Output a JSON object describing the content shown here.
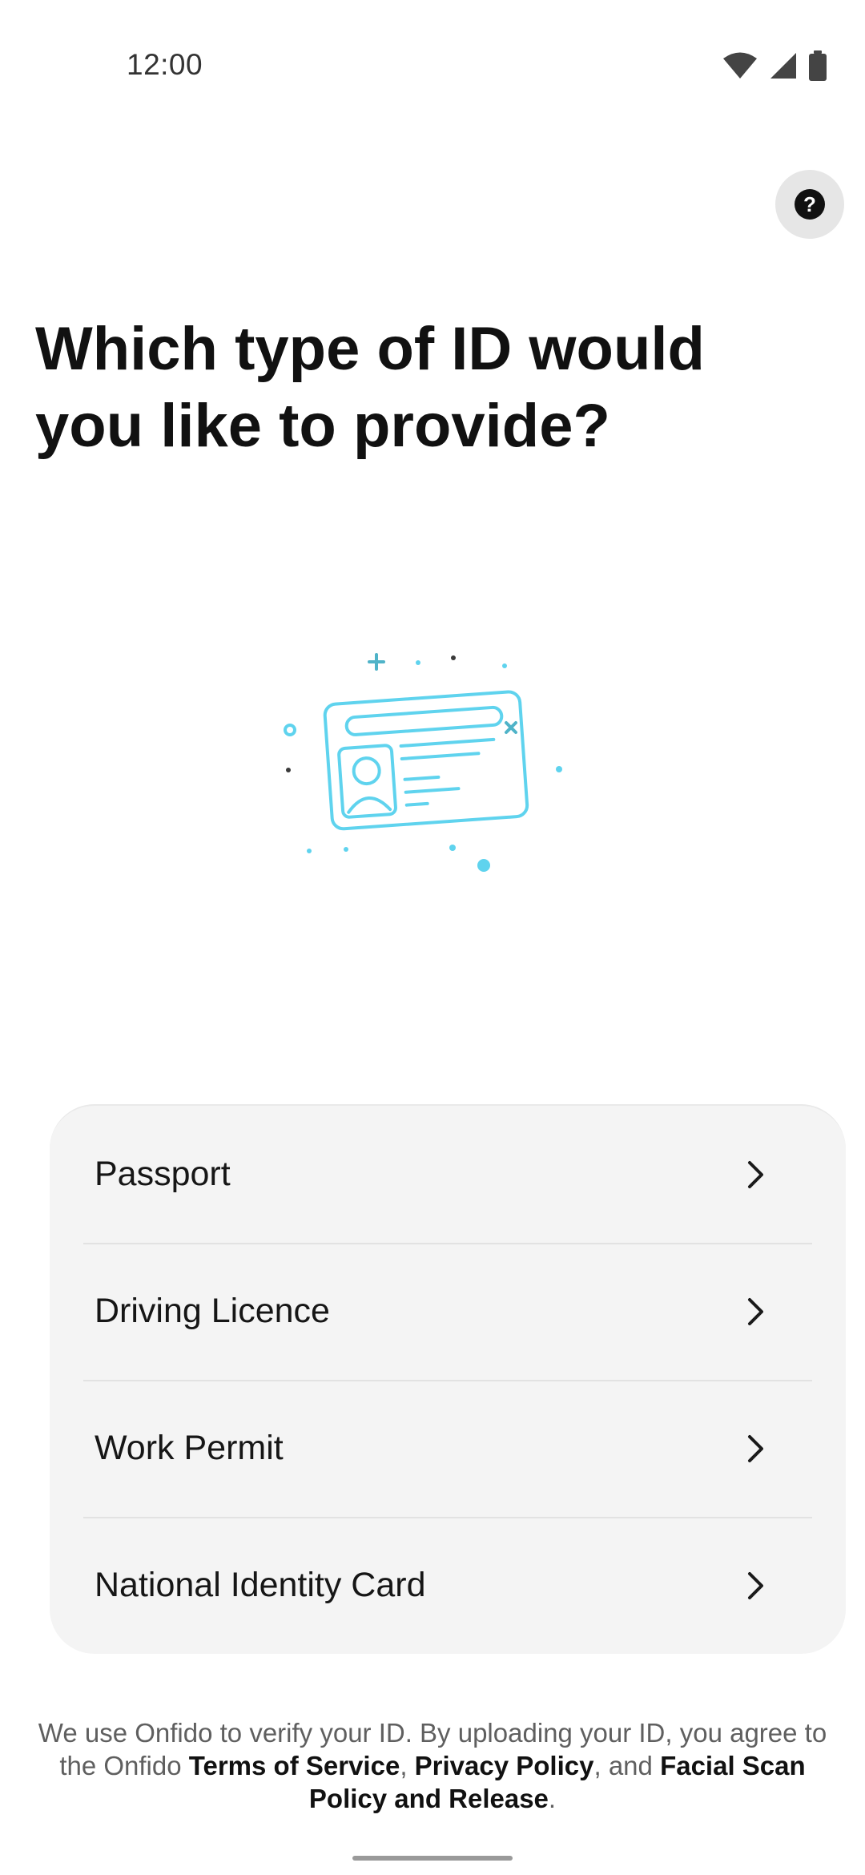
{
  "status_bar": {
    "time": "12:00",
    "icons": [
      "wifi-icon",
      "signal-icon",
      "battery-icon"
    ]
  },
  "header": {
    "help_icon": "question-mark-icon",
    "title": "Which type of ID would you like to provide?"
  },
  "illustration": {
    "icon": "id-card-illustration",
    "accent_color": "#5fd3ee"
  },
  "documents": [
    {
      "label": "Passport",
      "icon": "chevron-right-icon"
    },
    {
      "label": "Driving Licence",
      "icon": "chevron-right-icon"
    },
    {
      "label": "Work Permit",
      "icon": "chevron-right-icon"
    },
    {
      "label": "National Identity Card",
      "icon": "chevron-right-icon"
    }
  ],
  "consent": {
    "prefix": "We use Onfido to verify your ID. By uploading your ID, you agree to the Onfido ",
    "terms": "Terms of Service",
    "sep1": ", ",
    "privacy": "Privacy Policy",
    "sep2": ", and ",
    "facial": "Facial Scan Policy and Release",
    "suffix": "."
  }
}
